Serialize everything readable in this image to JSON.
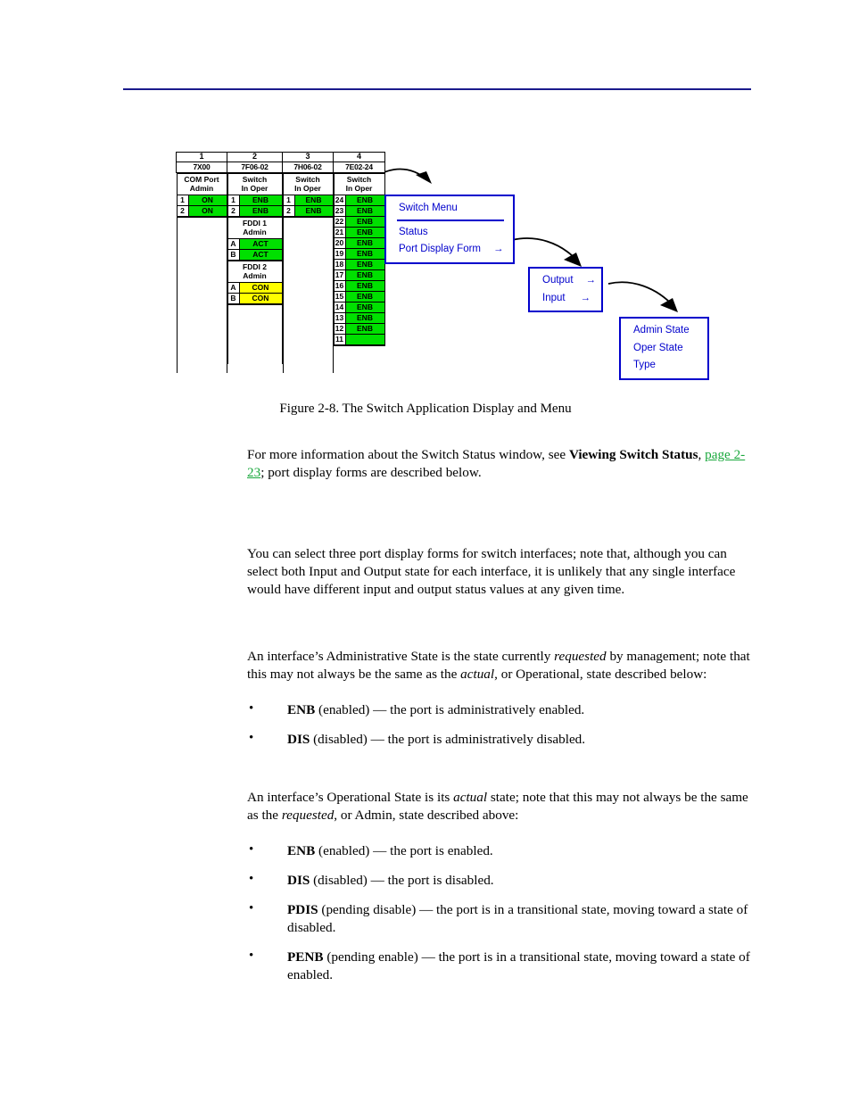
{
  "page": {
    "rule_color": "#1a1a8c",
    "link_color": "#19a83c"
  },
  "figure": {
    "caption": "Figure 2-8.  The Switch Application Display and Menu",
    "switch_display": {
      "columns": [
        {
          "slot_number": "1",
          "module_type": "7X00",
          "title_line1": "COM Port",
          "title_line2": "Admin",
          "ports": [
            {
              "num": "1",
              "value": "ON",
              "color": "green"
            },
            {
              "num": "2",
              "value": "ON",
              "color": "green"
            }
          ],
          "groups": []
        },
        {
          "slot_number": "2",
          "module_type": "7F06-02",
          "title_line1": "Switch",
          "title_line2": "In Oper",
          "ports": [
            {
              "num": "1",
              "value": "ENB",
              "color": "green"
            },
            {
              "num": "2",
              "value": "ENB",
              "color": "green"
            }
          ],
          "groups": [
            {
              "header_line1": "FDDI 1",
              "header_line2": "Admin",
              "ports": [
                {
                  "num": "A",
                  "value": "ACT",
                  "color": "green"
                },
                {
                  "num": "B",
                  "value": "ACT",
                  "color": "green"
                }
              ]
            },
            {
              "header_line1": "FDDI 2",
              "header_line2": "Admin",
              "ports": [
                {
                  "num": "A",
                  "value": "CON",
                  "color": "yellow"
                },
                {
                  "num": "B",
                  "value": "CON",
                  "color": "yellow"
                }
              ]
            }
          ]
        },
        {
          "slot_number": "3",
          "module_type": "7H06-02",
          "title_line1": "Switch",
          "title_line2": "In Oper",
          "ports": [
            {
              "num": "1",
              "value": "ENB",
              "color": "green"
            },
            {
              "num": "2",
              "value": "ENB",
              "color": "green"
            }
          ],
          "groups": []
        },
        {
          "slot_number": "4",
          "module_type": "7E02-24",
          "title_line1": "Switch",
          "title_line2": "In Oper",
          "ports": [
            {
              "num": "24",
              "value": "ENB",
              "color": "green"
            },
            {
              "num": "23",
              "value": "ENB",
              "color": "green"
            },
            {
              "num": "22",
              "value": "ENB",
              "color": "green"
            },
            {
              "num": "21",
              "value": "ENB",
              "color": "green"
            },
            {
              "num": "20",
              "value": "ENB",
              "color": "green"
            },
            {
              "num": "19",
              "value": "ENB",
              "color": "green"
            },
            {
              "num": "18",
              "value": "ENB",
              "color": "green"
            },
            {
              "num": "17",
              "value": "ENB",
              "color": "green"
            },
            {
              "num": "16",
              "value": "ENB",
              "color": "green"
            },
            {
              "num": "15",
              "value": "ENB",
              "color": "green"
            },
            {
              "num": "14",
              "value": "ENB",
              "color": "green"
            },
            {
              "num": "13",
              "value": "ENB",
              "color": "green"
            },
            {
              "num": "12",
              "value": "ENB",
              "color": "green"
            },
            {
              "num": "11",
              "value": "",
              "color": "green"
            }
          ],
          "groups": []
        }
      ]
    },
    "menus": [
      {
        "name": "switch-menu",
        "title": "Switch Menu",
        "items": [
          {
            "label": "Status",
            "arrow": ""
          },
          {
            "label": "Port Display Form",
            "arrow": "→"
          }
        ]
      },
      {
        "name": "port-display-form-menu",
        "title": "",
        "items": [
          {
            "label": "Output",
            "arrow": "→"
          },
          {
            "label": "Input",
            "arrow": "→"
          }
        ]
      },
      {
        "name": "state-menu",
        "title": "",
        "items": [
          {
            "label": "Admin State",
            "arrow": ""
          },
          {
            "label": "Oper State",
            "arrow": ""
          },
          {
            "label": "Type",
            "arrow": ""
          }
        ]
      }
    ]
  },
  "content": {
    "intro": {
      "part1": "For more information about the Switch Status window, see ",
      "bold1": "Viewing Switch Status",
      "part2": ", ",
      "link": "page 2-23",
      "part3": "; port display forms are described below."
    },
    "forms_paragraph": "You can select three port display forms for switch interfaces; note that, although you can select both Input and Output state for each interface, it is unlikely that any single interface would have different input and output status values at any given time.",
    "admin_state": {
      "p1": "An interface’s Administrative State is the state currently ",
      "i1": "requested",
      "p2": " by management; note that this may not always be the same as the ",
      "i2": "actual",
      "p3": ", or Operational, state described below:",
      "bullets": [
        {
          "term": "ENB",
          "rest": " (enabled) — the port is administratively enabled."
        },
        {
          "term": "DIS",
          "rest": " (disabled) — the port is administratively disabled."
        }
      ]
    },
    "oper_state": {
      "p1": "An interface’s Operational State is its ",
      "i1": "actual",
      "p2": " state; note that this may not always be the same as the ",
      "i2": "requested",
      "p3": ", or Admin, state described above:",
      "bullets": [
        {
          "term": "ENB",
          "rest": " (enabled) — the port is enabled."
        },
        {
          "term": "DIS",
          "rest": " (disabled) — the port is disabled."
        },
        {
          "term": "PDIS",
          "rest": " (pending disable) — the port is in a transitional state, moving toward a state of disabled."
        },
        {
          "term": "PENB",
          "rest": " (pending enable) — the port is in a transitional state, moving toward a state of enabled."
        }
      ]
    }
  }
}
